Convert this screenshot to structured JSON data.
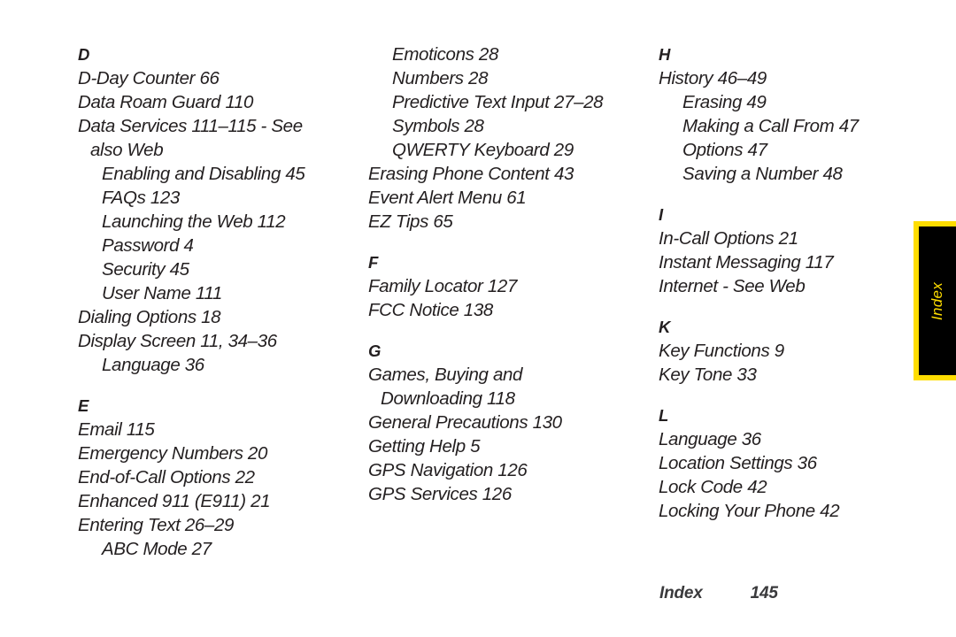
{
  "document": {
    "page_type": "index",
    "footer": {
      "label": "Index",
      "page_number": "145"
    },
    "thumb_tab": {
      "label": "Index",
      "background_color": "#000000",
      "border_color": "#ffdd00",
      "text_color": "#ffdd00"
    },
    "text_color": "#231f20",
    "background_color": "#ffffff"
  },
  "columns": [
    {
      "id": "column-1",
      "sections": [
        {
          "letter": "D",
          "first": true,
          "entries": [
            {
              "text": "D-Day Counter 66",
              "level": 0
            },
            {
              "text": "Data Roam Guard  110",
              "level": 0
            },
            {
              "text": "Data Services  111–115 - See",
              "level": 0
            },
            {
              "text": "also Web",
              "level": 1
            },
            {
              "text": "Enabling and Disabling  45",
              "level": 2
            },
            {
              "text": "FAQs  123",
              "level": 2
            },
            {
              "text": "Launching the Web  112",
              "level": 2
            },
            {
              "text": "Password  4",
              "level": 2
            },
            {
              "text": "Security  45",
              "level": 2
            },
            {
              "text": "User Name  111",
              "level": 2
            },
            {
              "text": "Dialing Options  18",
              "level": 0
            },
            {
              "text": "Display Screen  11, 34–36",
              "level": 0
            },
            {
              "text": "Language  36",
              "level": 2
            }
          ]
        },
        {
          "letter": "E",
          "first": false,
          "entries": [
            {
              "text": "Email  115",
              "level": 0
            },
            {
              "text": "Emergency Numbers 20",
              "level": 0
            },
            {
              "text": "End-of-Call Options  22",
              "level": 0
            },
            {
              "text": "Enhanced 911 (E911)  21",
              "level": 0
            },
            {
              "text": "Entering Text  26–29",
              "level": 0
            },
            {
              "text": "ABC Mode  27",
              "level": 2
            }
          ]
        }
      ]
    },
    {
      "id": "column-2",
      "sections": [
        {
          "letter": "",
          "first": true,
          "entries": [
            {
              "text": "Emoticons  28",
              "level": 2
            },
            {
              "text": "Numbers  28",
              "level": 2
            },
            {
              "text": "Predictive Text Input  27–28",
              "level": 2
            },
            {
              "text": "Symbols  28",
              "level": 2
            },
            {
              "text": "QWERTY Keyboard  29",
              "level": 2
            },
            {
              "text": "Erasing Phone Content  43",
              "level": 0
            },
            {
              "text": "Event Alert Menu  61",
              "level": 0
            },
            {
              "text": "EZ Tips  65",
              "level": 0
            }
          ]
        },
        {
          "letter": "F",
          "first": false,
          "entries": [
            {
              "text": "Family Locator 127",
              "level": 0
            },
            {
              "text": "FCC Notice  138",
              "level": 0
            }
          ]
        },
        {
          "letter": "G",
          "first": false,
          "entries": [
            {
              "text": "Games, Buying and",
              "level": 0
            },
            {
              "text": "Downloading  118",
              "level": 1
            },
            {
              "text": "General Precautions  130",
              "level": 0
            },
            {
              "text": "Getting Help  5",
              "level": 0
            },
            {
              "text": "GPS Navigation  126",
              "level": 0
            },
            {
              "text": "GPS Services  126",
              "level": 0
            }
          ]
        }
      ]
    },
    {
      "id": "column-3",
      "sections": [
        {
          "letter": "H",
          "first": true,
          "entries": [
            {
              "text": "History  46–49",
              "level": 0
            },
            {
              "text": "Erasing  49",
              "level": 2
            },
            {
              "text": "Making a Call From  47",
              "level": 2
            },
            {
              "text": "Options  47",
              "level": 2
            },
            {
              "text": "Saving a Number  48",
              "level": 2
            }
          ]
        },
        {
          "letter": "I",
          "first": false,
          "entries": [
            {
              "text": "In-Call Options  21",
              "level": 0
            },
            {
              "text": "Instant Messaging  117",
              "level": 0
            },
            {
              "text": "Internet - See Web",
              "level": 0
            }
          ]
        },
        {
          "letter": "K",
          "first": false,
          "entries": [
            {
              "text": "Key Functions  9",
              "level": 0
            },
            {
              "text": "Key Tone  33",
              "level": 0
            }
          ]
        },
        {
          "letter": "L",
          "first": false,
          "entries": [
            {
              "text": "Language  36",
              "level": 0
            },
            {
              "text": "Location Settings  36",
              "level": 0
            },
            {
              "text": "Lock Code  42",
              "level": 0
            },
            {
              "text": "Locking Your Phone  42",
              "level": 0
            }
          ]
        }
      ]
    }
  ]
}
